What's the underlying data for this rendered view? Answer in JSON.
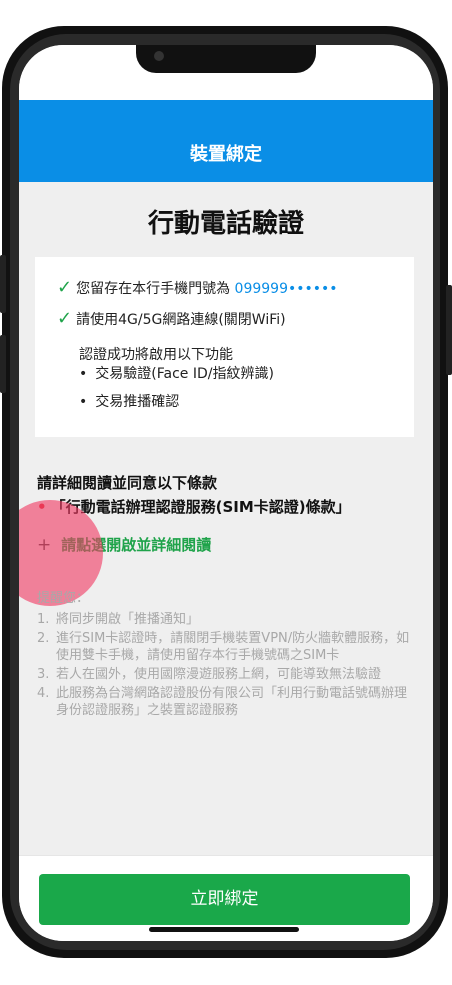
{
  "header": {
    "title": "裝置綁定"
  },
  "page": {
    "title": "行動電話驗證"
  },
  "card": {
    "check_1_prefix": "您留存在本行手機門號為",
    "phone_number": "099999••••••",
    "check_2": "請使用4G/5G網路連線(關閉WiFi)",
    "features_intro": "認證成功將啟用以下功能",
    "features": [
      "交易驗證(Face ID/指紋辨識)",
      "交易推播確認"
    ]
  },
  "terms": {
    "heading": "請詳細閱讀並同意以下條款",
    "item": "「行動電話辦理認證服務(SIM卡認證)條款」",
    "expand_label": "請點選開啟並詳細閱讀"
  },
  "reminder": {
    "title": "提醒您：",
    "items": [
      "將同步開啟「推播通知」",
      "進行SIM卡認證時，請關閉手機裝置VPN/防火牆軟體服務，如使用雙卡手機，請使用留存本行手機號碼之SIM卡",
      "若人在國外，使用國際漫遊服務上網，可能導致無法驗證",
      "此服務為台灣網路認證股份有限公司「利用行動電話號碼辦理身份認證服務」之裝置認證服務"
    ]
  },
  "footer": {
    "bind_button": "立即綁定"
  },
  "colors": {
    "brand_blue": "#0a8ee6",
    "confirm_green": "#1aa84a",
    "bullet_red": "#e0323a"
  }
}
